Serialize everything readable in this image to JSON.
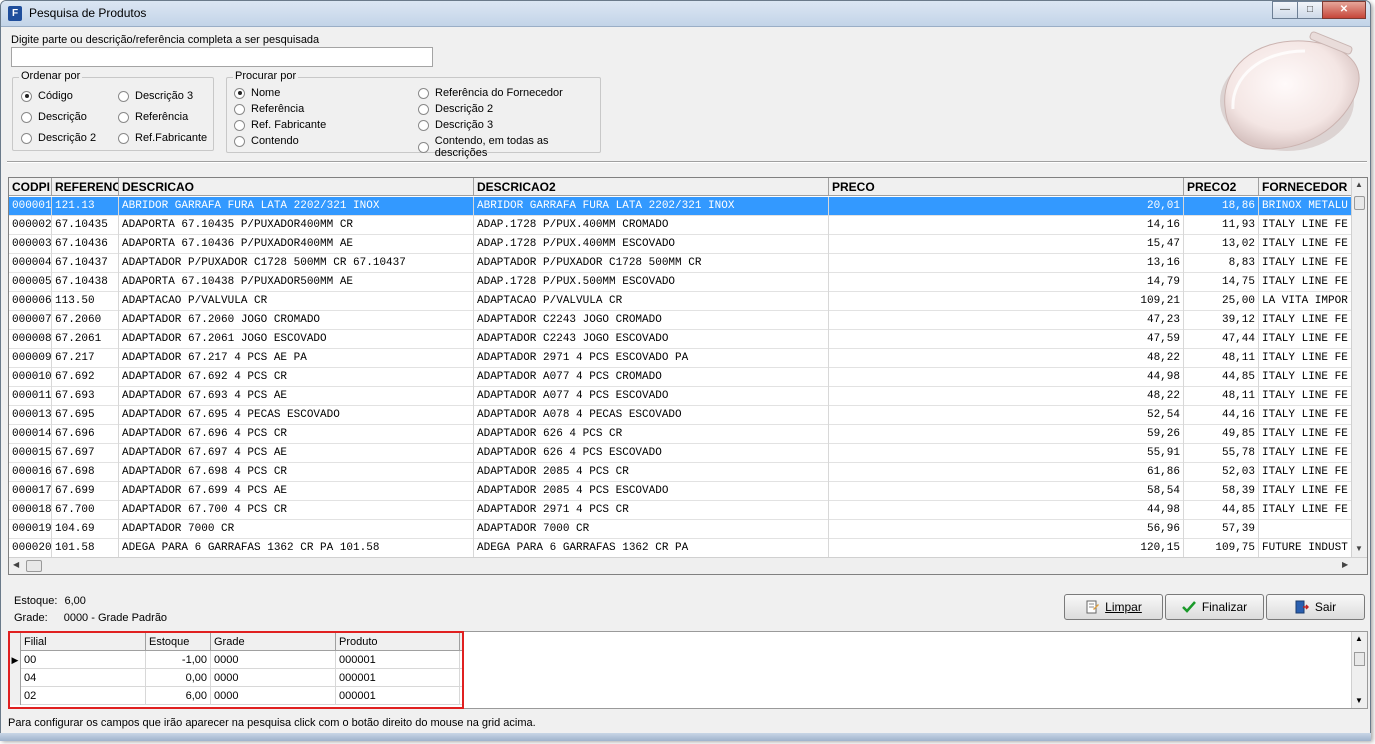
{
  "window": {
    "title": "Pesquisa de Produtos",
    "icon_letter": "F",
    "minimize_label": "—",
    "maximize_label": "□",
    "close_label": "✕"
  },
  "search": {
    "label": "Digite parte ou  descrição/referência completa a ser pesquisada",
    "value": "",
    "placeholder": ""
  },
  "order_by": {
    "title": "Ordenar por",
    "options": [
      "Código",
      "Descrição",
      "Descrição 2",
      "Descrição 3",
      "Referência",
      "Ref.Fabricante"
    ],
    "selected": "Código"
  },
  "search_by": {
    "title": "Procurar por",
    "options": [
      "Nome",
      "Referência",
      "Ref. Fabricante",
      "Contendo",
      "Referência do Fornecedor",
      "Descrição 2",
      "Descrição 3",
      "Contendo, em todas as descrições"
    ],
    "selected": "Nome"
  },
  "grid": {
    "columns": [
      "CODPI",
      "REFERENC",
      "DESCRICAO",
      "DESCRICAO2",
      "PRECO",
      "PRECO2",
      "FORNECEDOR"
    ],
    "rows": [
      [
        "000001",
        "121.13",
        "ABRIDOR GARRAFA FURA LATA 2202/321 INOX",
        "ABRIDOR GARRAFA FURA LATA 2202/321 INOX",
        "20,01",
        "18,86",
        "BRINOX METALU"
      ],
      [
        "000002",
        "67.10435",
        "ADAPORTA 67.10435 P/PUXADOR400MM CR",
        "ADAP.1728 P/PUX.400MM CROMADO",
        "14,16",
        "11,93",
        "ITALY LINE FE"
      ],
      [
        "000003",
        "67.10436",
        "ADAPORTA 67.10436 P/PUXADOR400MM AE",
        "ADAP.1728 P/PUX.400MM ESCOVADO",
        "15,47",
        "13,02",
        "ITALY LINE FE"
      ],
      [
        "000004",
        "67.10437",
        "ADAPTADOR P/PUXADOR C1728 500MM CR 67.10437",
        "ADAPTADOR P/PUXADOR C1728 500MM CR",
        "13,16",
        "8,83",
        "ITALY LINE FE"
      ],
      [
        "000005",
        "67.10438",
        "ADAPORTA 67.10438 P/PUXADOR500MM AE",
        "ADAP.1728 P/PUX.500MM ESCOVADO",
        "14,79",
        "14,75",
        "ITALY LINE FE"
      ],
      [
        "000006",
        "113.50",
        "ADAPTACAO P/VALVULA CR",
        "ADAPTACAO P/VALVULA CR",
        "109,21",
        "25,00",
        "LA VITA IMPOR"
      ],
      [
        "000007",
        "67.2060",
        "ADAPTADOR 67.2060 JOGO CROMADO",
        "ADAPTADOR C2243 JOGO CROMADO",
        "47,23",
        "39,12",
        "ITALY LINE FE"
      ],
      [
        "000008",
        "67.2061",
        "ADAPTADOR 67.2061 JOGO ESCOVADO",
        "ADAPTADOR C2243 JOGO ESCOVADO",
        "47,59",
        "47,44",
        "ITALY LINE FE"
      ],
      [
        "000009",
        "67.217",
        "ADAPTADOR 67.217 4 PCS AE PA",
        "ADAPTADOR 2971 4 PCS ESCOVADO PA",
        "48,22",
        "48,11",
        "ITALY LINE FE"
      ],
      [
        "000010",
        "67.692",
        "ADAPTADOR 67.692 4 PCS CR",
        "ADAPTADOR A077 4 PCS CROMADO",
        "44,98",
        "44,85",
        "ITALY LINE FE"
      ],
      [
        "000011",
        "67.693",
        "ADAPTADOR 67.693 4 PCS AE",
        "ADAPTADOR A077 4 PCS ESCOVADO",
        "48,22",
        "48,11",
        "ITALY LINE FE"
      ],
      [
        "000013",
        "67.695",
        "ADAPTADOR 67.695 4 PECAS ESCOVADO",
        "ADAPTADOR A078 4 PECAS ESCOVADO",
        "52,54",
        "44,16",
        "ITALY LINE FE"
      ],
      [
        "000014",
        "67.696",
        "ADAPTADOR 67.696 4 PCS CR",
        "ADAPTADOR 626 4 PCS CR",
        "59,26",
        "49,85",
        "ITALY LINE FE"
      ],
      [
        "000015",
        "67.697",
        "ADAPTADOR 67.697 4 PCS AE",
        "ADAPTADOR 626 4 PCS ESCOVADO",
        "55,91",
        "55,78",
        "ITALY LINE FE"
      ],
      [
        "000016",
        "67.698",
        "ADAPTADOR 67.698 4 PCS CR",
        "ADAPTADOR 2085 4 PCS CR",
        "61,86",
        "52,03",
        "ITALY LINE FE"
      ],
      [
        "000017",
        "67.699",
        "ADAPTADOR 67.699 4 PCS AE",
        "ADAPTADOR 2085 4 PCS ESCOVADO",
        "58,54",
        "58,39",
        "ITALY LINE FE"
      ],
      [
        "000018",
        "67.700",
        "ADAPTADOR 67.700 4 PCS CR",
        "ADAPTADOR 2971 4 PCS CR",
        "44,98",
        "44,85",
        "ITALY LINE FE"
      ],
      [
        "000019",
        "104.69",
        "ADAPTADOR 7000 CR",
        "ADAPTADOR 7000 CR",
        "56,96",
        "57,39",
        ""
      ],
      [
        "000020",
        "101.58",
        "ADEGA PARA 6 GARRAFAS 1362 CR PA 101.58",
        "ADEGA PARA 6 GARRAFAS 1362 CR PA",
        "120,15",
        "109,75",
        "FUTURE INDUST"
      ]
    ]
  },
  "info": {
    "estoque_label": "Estoque:",
    "estoque_value": "6,00",
    "grade_label": "Grade:",
    "grade_value": "0000 - Grade Padrão"
  },
  "buttons": {
    "limpar": "Limpar",
    "finalizar": "Finalizar",
    "sair": "Sair"
  },
  "stock_grid": {
    "columns": [
      "Filial",
      "Estoque",
      "Grade",
      "Produto"
    ],
    "rows": [
      [
        "00",
        "-1,00",
        "0000",
        "000001"
      ],
      [
        "04",
        "0,00",
        "0000",
        "000001"
      ],
      [
        "02",
        "6,00",
        "0000",
        "000001"
      ]
    ]
  },
  "status": {
    "text": "Para configurar os campos que irão aparecer na pesquisa click com o botão direito do mouse na grid acima."
  },
  "colors": {
    "selection": "#3399ff",
    "highlight_border": "#e02020"
  }
}
